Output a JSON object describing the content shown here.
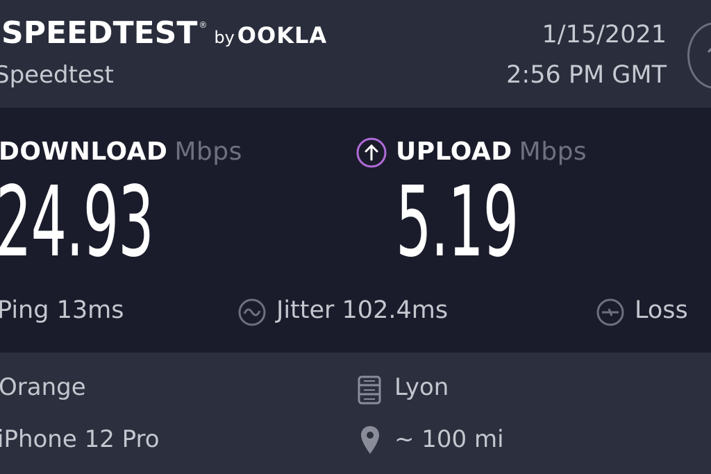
{
  "header": {
    "brand_name": "SPEEDTEST",
    "brand_tm": "®",
    "brand_by": "by",
    "brand_company": "OOKLA",
    "subtitle": "Speedtest",
    "date": "1/15/2021",
    "time": "2:56 PM GMT"
  },
  "results": {
    "download": {
      "label": "DOWNLOAD",
      "unit": "Mbps",
      "value": "24.93"
    },
    "upload": {
      "label": "UPLOAD",
      "unit": "Mbps",
      "value": "5.19"
    },
    "ping": "Ping 13ms",
    "jitter": "Jitter 102.4ms",
    "loss": "Loss"
  },
  "info": {
    "isp": "Orange",
    "device": "iPhone 12 Pro",
    "server": "Lyon",
    "distance": "~ 100 mi"
  },
  "colors": {
    "header_bg": "#292d3c",
    "panel_bg": "#1b1c2b",
    "upload_accent": "#b06bd8",
    "unit_gray": "#6e7080"
  },
  "icons": {
    "upload": "upload-arrow-icon",
    "jitter": "jitter-icon",
    "loss": "packet-loss-icon",
    "server": "server-icon",
    "location": "location-pin-icon",
    "share": "share-icon"
  }
}
